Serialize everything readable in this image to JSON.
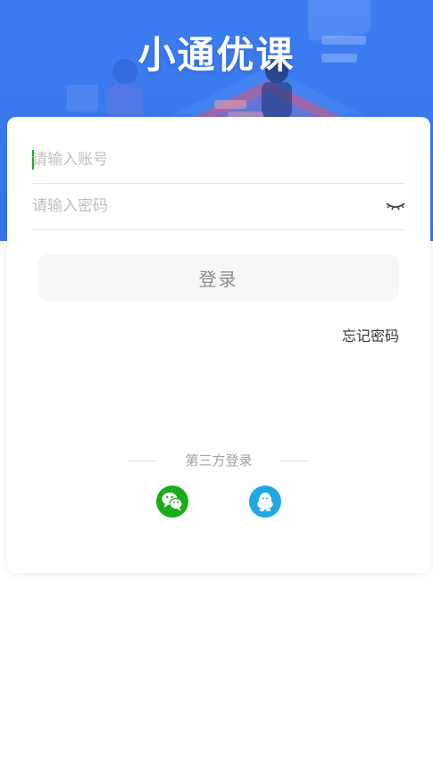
{
  "app": {
    "title": "小通优课"
  },
  "login_form": {
    "account_placeholder": "请输入账号",
    "account_value": "",
    "password_placeholder": "请输入密码",
    "password_value": "",
    "password_visibility_icon": "eye-closed-icon",
    "login_label": "登录",
    "forgot_password_label": "忘记密码"
  },
  "third_party": {
    "label": "第三方登录",
    "providers": [
      {
        "name": "wechat",
        "icon": "wechat-icon",
        "color": "#1aad19"
      },
      {
        "name": "qq",
        "icon": "qq-icon",
        "color": "#22a7e6"
      }
    ]
  },
  "colors": {
    "brand_blue": "#3c7cf0",
    "caret_green": "#1aad19",
    "wechat_green": "#1aad19",
    "qq_blue": "#22a7e6"
  }
}
